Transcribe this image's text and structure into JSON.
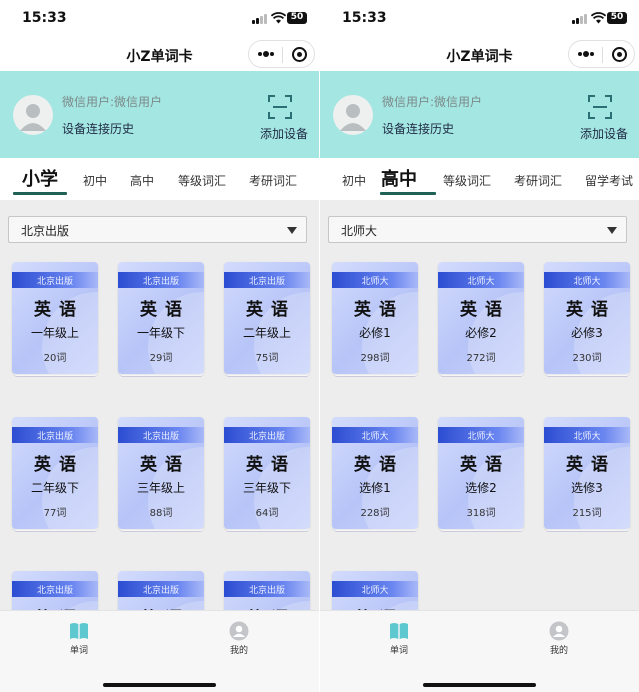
{
  "colors": {
    "header_bg": "#a4e6e2",
    "tab_underline": "#1f6157",
    "book_band": "#2c4dd2",
    "book_cover": "#c4cffa",
    "content_bg": "#ededed"
  },
  "panels": [
    {
      "status": {
        "time": "15:33",
        "battery": "50"
      },
      "nav_title": "小Z单词卡",
      "user": {
        "name": "微信用户:微信用户",
        "history": "设备连接历史",
        "add_device": "添加设备"
      },
      "tabs": [
        {
          "label": "小学",
          "active": true
        },
        {
          "label": "初中",
          "active": false
        },
        {
          "label": "高中",
          "active": false
        },
        {
          "label": "等级词汇",
          "active": false
        },
        {
          "label": "考研词汇",
          "active": false
        }
      ],
      "select_value": "北京出版",
      "books": [
        {
          "publisher": "北京出版",
          "subject": "英语",
          "grade": "一年级上",
          "count": "20词"
        },
        {
          "publisher": "北京出版",
          "subject": "英语",
          "grade": "一年级下",
          "count": "29词"
        },
        {
          "publisher": "北京出版",
          "subject": "英语",
          "grade": "二年级上",
          "count": "75词"
        },
        {
          "publisher": "北京出版",
          "subject": "英语",
          "grade": "二年级下",
          "count": "77词"
        },
        {
          "publisher": "北京出版",
          "subject": "英语",
          "grade": "三年级上",
          "count": "88词"
        },
        {
          "publisher": "北京出版",
          "subject": "英语",
          "grade": "三年级下",
          "count": "64词"
        },
        {
          "publisher": "北京出版",
          "subject": "英语",
          "grade": "",
          "count": ""
        },
        {
          "publisher": "北京出版",
          "subject": "英语",
          "grade": "",
          "count": ""
        },
        {
          "publisher": "北京出版",
          "subject": "英语",
          "grade": "",
          "count": ""
        }
      ],
      "tabbar": {
        "words": "单词",
        "mine": "我的"
      }
    },
    {
      "status": {
        "time": "15:33",
        "battery": "50"
      },
      "nav_title": "小Z单词卡",
      "user": {
        "name": "微信用户:微信用户",
        "history": "设备连接历史",
        "add_device": "添加设备"
      },
      "tabs": [
        {
          "label": "初中",
          "active": false
        },
        {
          "label": "高中",
          "active": true
        },
        {
          "label": "等级词汇",
          "active": false
        },
        {
          "label": "考研词汇",
          "active": false
        },
        {
          "label": "留学考试",
          "active": false
        }
      ],
      "select_value": "北师大",
      "books": [
        {
          "publisher": "北师大",
          "subject": "英语",
          "grade": "必修1",
          "count": "298词"
        },
        {
          "publisher": "北师大",
          "subject": "英语",
          "grade": "必修2",
          "count": "272词"
        },
        {
          "publisher": "北师大",
          "subject": "英语",
          "grade": "必修3",
          "count": "230词"
        },
        {
          "publisher": "北师大",
          "subject": "英语",
          "grade": "选修1",
          "count": "228词"
        },
        {
          "publisher": "北师大",
          "subject": "英语",
          "grade": "选修2",
          "count": "318词"
        },
        {
          "publisher": "北师大",
          "subject": "英语",
          "grade": "选修3",
          "count": "215词"
        },
        {
          "publisher": "北师大",
          "subject": "英语",
          "grade": "",
          "count": ""
        }
      ],
      "tabbar": {
        "words": "单词",
        "mine": "我的"
      }
    }
  ]
}
